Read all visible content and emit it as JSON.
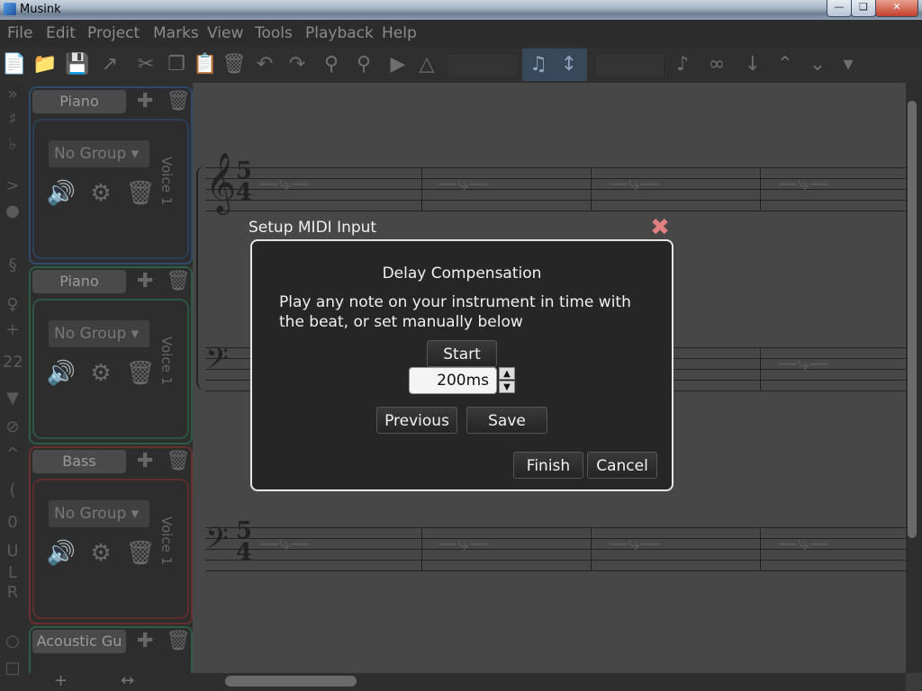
{
  "window": {
    "title": "Musink"
  },
  "menu": [
    "File",
    "Edit",
    "Project",
    "Marks",
    "View",
    "Tools",
    "Playback",
    "Help"
  ],
  "toolbar_icons": [
    "new-file-icon",
    "open-folder-icon",
    "save-icon",
    "export-icon",
    "cut-icon",
    "copy-icon",
    "paste-icon",
    "delete-icon",
    "undo-icon",
    "redo-icon",
    "zoom-out-icon",
    "zoom-in-icon",
    "play-icon",
    "metronome-icon",
    "note-visibility-icon",
    "note-spacing-icon",
    "stems-icon",
    "articulation-icon",
    "arrow-down-icon",
    "arrow-up-icon",
    "chevron-down-icon",
    "expand-icon"
  ],
  "instruments": [
    {
      "name": "Piano",
      "group": "No Group",
      "voice": "Voice 1",
      "color": "#2f4a6a"
    },
    {
      "name": "Piano",
      "group": "No Group",
      "voice": "Voice 1",
      "color": "#2f5c44"
    },
    {
      "name": "Bass",
      "group": "No Group",
      "voice": "Voice 1",
      "color": "#6a3030"
    },
    {
      "name": "Acoustic Gu",
      "group": "",
      "voice": "",
      "color": "#2f5c44"
    }
  ],
  "score": {
    "time_signature_top": "5",
    "time_signature_bottom": "4"
  },
  "dialog": {
    "title": "Setup MIDI Input",
    "heading": "Delay Compensation",
    "text": "Play any note on your instrument in time with the beat, or set manually below",
    "start_label": "Start",
    "delay_value": "200ms",
    "previous_label": "Previous",
    "save_label": "Save",
    "finish_label": "Finish",
    "cancel_label": "Cancel"
  }
}
